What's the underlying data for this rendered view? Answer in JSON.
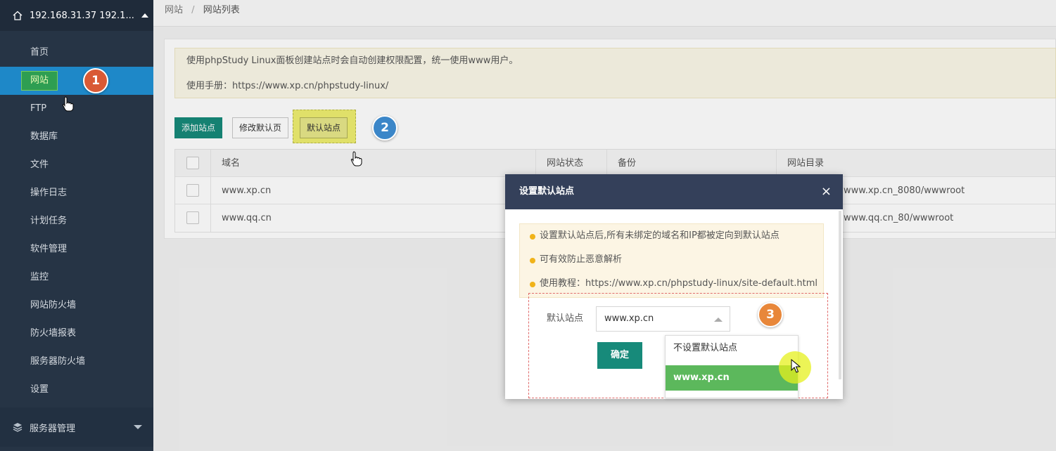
{
  "sidebar": {
    "server": "192.168.31.37 192.1...",
    "items": [
      {
        "label": "首页"
      },
      {
        "label": "网站"
      },
      {
        "label": "FTP"
      },
      {
        "label": "数据库"
      },
      {
        "label": "文件"
      },
      {
        "label": "操作日志"
      },
      {
        "label": "计划任务"
      },
      {
        "label": "软件管理"
      },
      {
        "label": "监控"
      },
      {
        "label": "网站防火墙"
      },
      {
        "label": "防火墙报表"
      },
      {
        "label": "服务器防火墙"
      },
      {
        "label": "设置"
      }
    ],
    "bottom": "服务器管理"
  },
  "breadcrumb": {
    "parent": "网站",
    "sep": "/",
    "current": "网站列表"
  },
  "notice": {
    "line1": "使用phpStudy Linux面板创建站点时会自动创建权限配置，统一使用www用户。",
    "line2": "使用手册：https://www.xp.cn/phpstudy-linux/"
  },
  "toolbar": {
    "add": "添加站点",
    "edit": "修改默认页",
    "default": "默认站点"
  },
  "badges": {
    "b1": "1",
    "b2": "2",
    "b3": "3"
  },
  "table": {
    "headers": {
      "domain": "域名",
      "status": "网站状态",
      "backup": "备份",
      "dir": "网站目录"
    },
    "rows": [
      {
        "domain": "www.xp.cn",
        "dir": "www.xp.cn_8080/wwwroot"
      },
      {
        "domain": "www.qq.cn",
        "dir": "www.qq.cn_80/wwwroot"
      }
    ]
  },
  "modal": {
    "title": "设置默认站点",
    "close": "×",
    "tips": [
      "设置默认站点后,所有未绑定的域名和IP都被定向到默认站点",
      "可有效防止恶意解析",
      "使用教程：https://www.xp.cn/phpstudy-linux/site-default.html"
    ],
    "label": "默认站点",
    "selected": "www.xp.cn",
    "ok": "确定",
    "options": [
      "不设置默认站点",
      "www.xp.cn"
    ]
  },
  "colors": {
    "sidebar": "#263445",
    "active": "#1e88c8",
    "primary": "#178a7a",
    "modal_header": "#34405a",
    "option_selected": "#5cb85c"
  }
}
